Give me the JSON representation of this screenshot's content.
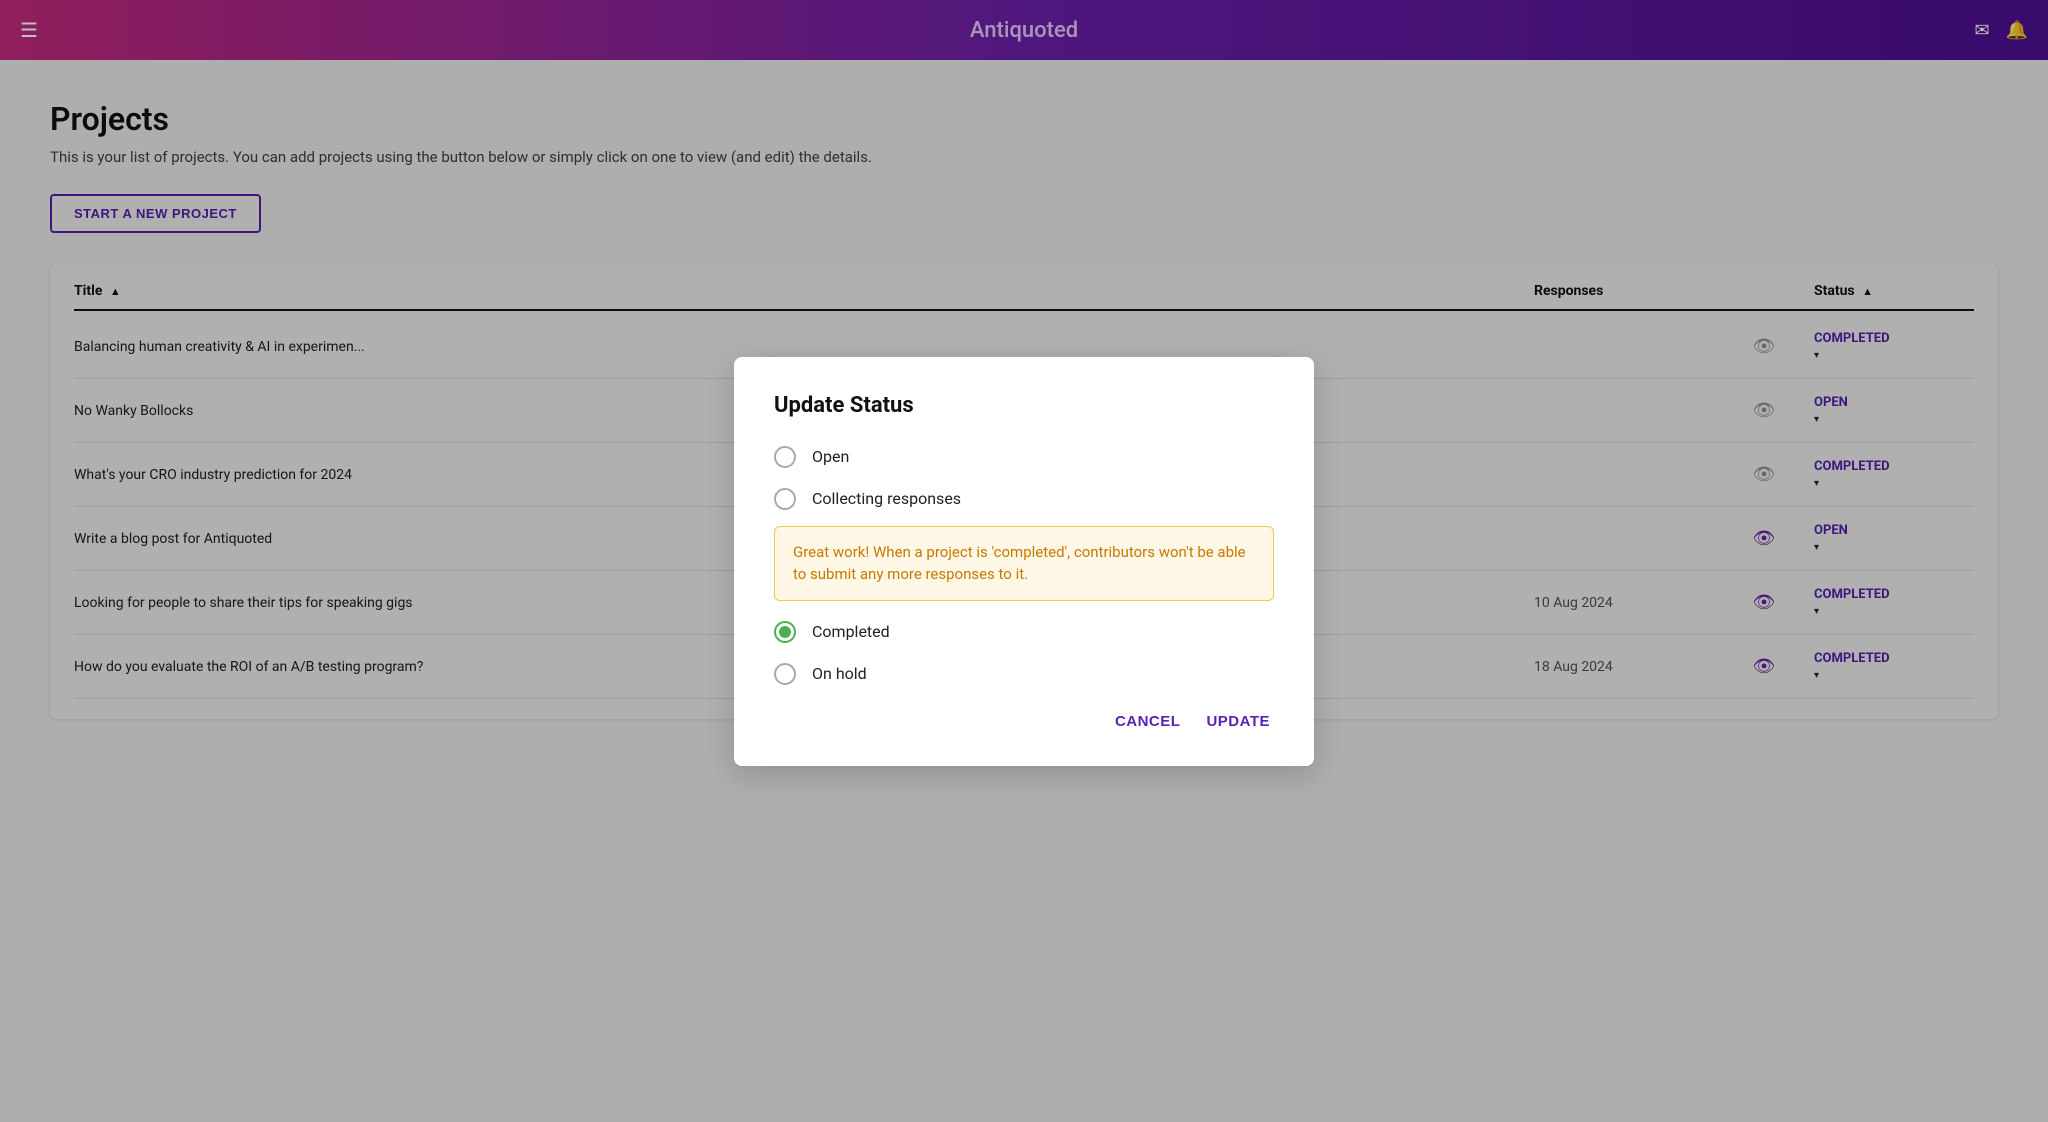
{
  "app": {
    "title": "Antiquoted"
  },
  "header": {
    "menu_icon": "☰",
    "mail_icon": "✉",
    "bell_icon": "🔔"
  },
  "page": {
    "title": "Projects",
    "description": "This is your list of projects. You can add projects using the button below or simply click on one to view (and edit) the details.",
    "new_project_button": "START A NEW PROJECT"
  },
  "table": {
    "columns": [
      {
        "label": "Title",
        "sort": true
      },
      {
        "label": "Responses",
        "sort": false
      },
      {
        "label": "",
        "sort": false
      },
      {
        "label": "Status",
        "sort": true
      }
    ],
    "rows": [
      {
        "title": "Balancing human creativity & AI in experimen...",
        "date": "",
        "status": "COMPLETED"
      },
      {
        "title": "No Wanky Bollocks",
        "date": "",
        "status": "OPEN"
      },
      {
        "title": "What's your CRO industry prediction for 2024",
        "date": "",
        "status": "COMPLETED"
      },
      {
        "title": "Write a blog post for Antiquoted",
        "date": "",
        "status": "OPEN"
      },
      {
        "title": "Looking for people to share their tips for speaking gigs",
        "date": "10 Aug 2024",
        "status": "COMPLETED"
      },
      {
        "title": "How do you evaluate the ROI of an A/B testing program?",
        "date": "18 Aug 2024",
        "status": "COMPLETED"
      }
    ]
  },
  "modal": {
    "title": "Update Status",
    "options": [
      {
        "id": "open",
        "label": "Open",
        "checked": false
      },
      {
        "id": "collecting",
        "label": "Collecting responses",
        "checked": false
      },
      {
        "id": "completed",
        "label": "Completed",
        "checked": true
      },
      {
        "id": "onhold",
        "label": "On hold",
        "checked": false
      }
    ],
    "warning": "Great work! When a project is 'completed', contributors won't be able to submit any more responses to it.",
    "cancel_label": "CANCEL",
    "update_label": "UPDATE"
  }
}
